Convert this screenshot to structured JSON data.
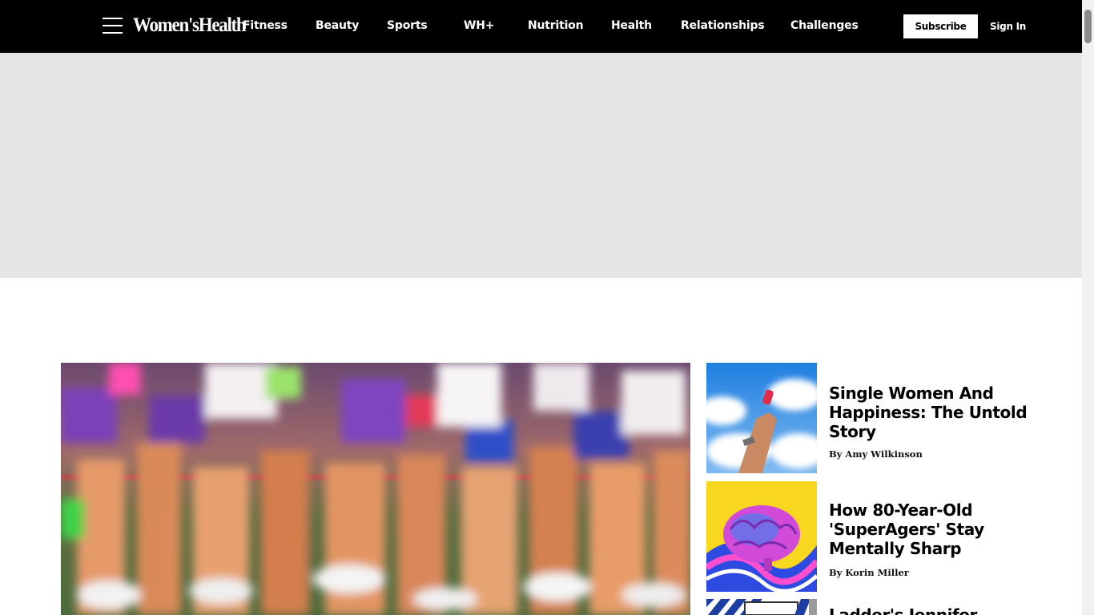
{
  "header": {
    "logo_text": "Women'sHealth",
    "menu_icon": "hamburger-menu-icon",
    "nav": [
      {
        "label": "Fitness"
      },
      {
        "label": "Beauty"
      },
      {
        "label": "Sports"
      },
      {
        "label": "WH+"
      },
      {
        "label": "Nutrition"
      },
      {
        "label": "Health"
      },
      {
        "label": "Relationships"
      },
      {
        "label": "Challenges"
      }
    ],
    "subscribe_label": "Subscribe",
    "signin_label": "Sign In"
  },
  "colors": {
    "nav_bg": "#000000",
    "ad_bg": "#e5e5e5",
    "text": "#000000",
    "accent_white": "#ffffff"
  },
  "hero": {
    "image": "blurred-runners-race-photo"
  },
  "stories": [
    {
      "headline": "Single Women And Happiness: The Untold Story",
      "byline": "By Amy Wilkinson",
      "image": "hand-holding-pill-against-sky"
    },
    {
      "headline": "How 80-Year-Old 'SuperAgers' Stay Mentally Sharp",
      "byline": "By Korin Miller",
      "image": "colorful-brain-illustration"
    },
    {
      "headline": "Ladder's Jennifer",
      "byline": "",
      "image": "striped-graphic-thumbnail"
    }
  ]
}
